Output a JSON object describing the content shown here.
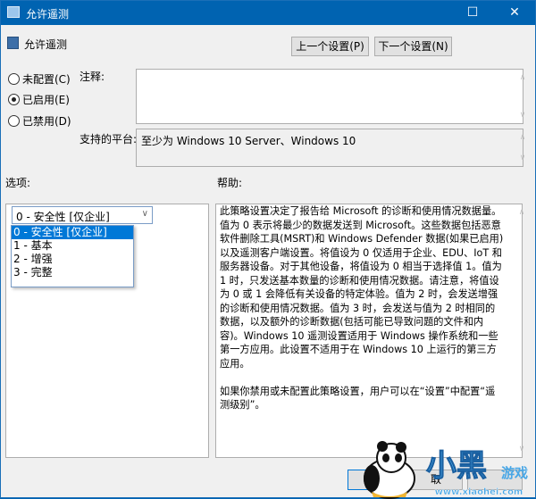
{
  "window": {
    "title": "允许遥测",
    "maximize_icon": "maximize-icon",
    "close_icon": "close-icon"
  },
  "header": {
    "policy_name": "允许遥测",
    "prev_button": "上一个设置(P)",
    "next_button": "下一个设置(N)"
  },
  "state": {
    "options": [
      {
        "label": "未配置(C)",
        "checked": false
      },
      {
        "label": "已启用(E)",
        "checked": true
      },
      {
        "label": "已禁用(D)",
        "checked": false
      }
    ]
  },
  "comment": {
    "label": "注释:",
    "value": ""
  },
  "platform": {
    "label": "支持的平台:",
    "value": "至少为 Windows 10 Server、Windows 10"
  },
  "options_panel": {
    "label": "选项:",
    "selected": "0 - 安全性 [仅企业]",
    "dropdown_items": [
      "0 - 安全性 [仅企业]",
      "1 - 基本",
      "2 - 增强",
      "3 - 完整"
    ]
  },
  "help_panel": {
    "label": "帮助:",
    "paragraphs": [
      "此策略设置决定了报告给 Microsoft 的诊断和使用情况数据量。值为 0 表示将最少的数据发送到 Microsoft。这些数据包括恶意软件删除工具(MSRT)和 Windows Defender 数据(如果已启用)以及遥测客户端设置。将值设为 0 仅适用于企业、EDU、IoT 和服务器设备。对于其他设备，将值设为 0 相当于选择值 1。值为 1 时，只发送基本数量的诊断和使用情况数据。请注意，将值设为 0 或 1 会降低有关设备的特定体验。值为 2 时，会发送增强的诊断和使用情况数据。值为 3 时，会发送与值为 2 时相同的数据，以及额外的诊断数据(包括可能已导致问题的文件和内容)。Windows 10 遥测设置适用于 Windows 操作系统和一些第一方应用。此设置不适用于在 Windows 10 上运行的第三方应用。",
      "如果你禁用或未配置此策略设置，用户可以在“设置”中配置“遥测级别”。"
    ]
  },
  "footer": {
    "cancel_partial": "取"
  },
  "watermark": {
    "text": "小黑游戏",
    "url": "www.xiaohei.com"
  },
  "colors": {
    "titlebar": "#0063b1",
    "selection": "#0078d7"
  }
}
